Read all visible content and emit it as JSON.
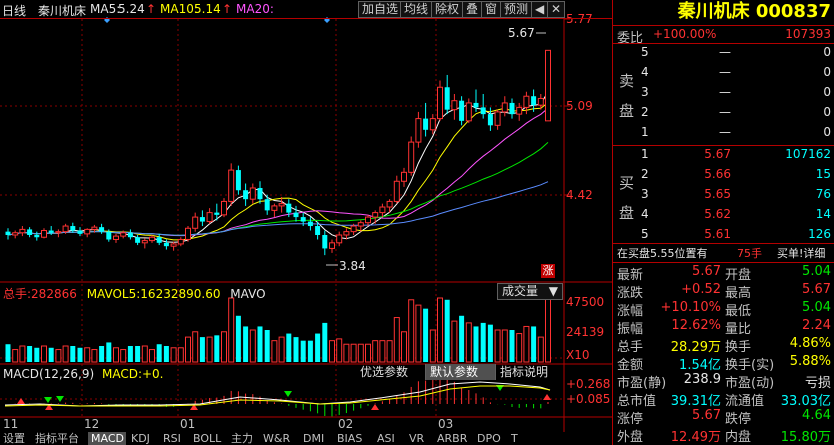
{
  "header": {
    "period": "日线",
    "name": "秦川机床",
    "ma5_label": "MA5:",
    "ma5_value": "5.24",
    "ma10_label": "MA10:",
    "ma10_value": "5.14",
    "ma20_label": "MA20:",
    "ma20_value": "",
    "buttons": [
      "加自选",
      "均线",
      "除权",
      "叠",
      "窗",
      "预测"
    ],
    "colors": {
      "ma5": "#ffffff",
      "ma10": "#ffff00",
      "ma20": "#ff55ff",
      "up": "#ff3232",
      "down": "#00ffff"
    }
  },
  "price_axis": [
    "5.77",
    "5.09",
    "4.42"
  ],
  "price_annotations": {
    "high": "5.67",
    "low": "3.84",
    "marker": "涨"
  },
  "volume": {
    "title_label": "总手:",
    "title_value": "282866",
    "mavol_label": "MAVOL5:",
    "mavol_value": "16232890.60",
    "mavo_label": "MAVO",
    "selector": "成交量",
    "axis": [
      "47500",
      "24139",
      "X10"
    ]
  },
  "macd": {
    "title": "MACD(12,26,9)",
    "macd_label": "MACD:",
    "macd_value": "+0.",
    "buttons": [
      "优选参数",
      "默认参数",
      "指标说明"
    ],
    "axis": [
      "+0.268",
      "+0.085"
    ]
  },
  "date_axis": [
    "11",
    "12",
    "01",
    "02",
    "03"
  ],
  "tabs": [
    "设置",
    "指标平台",
    "MACD",
    "KDJ",
    "RSI",
    "BOLL",
    "主力",
    "W&R",
    "DMI",
    "BIAS",
    "ASI",
    "VR",
    "ARBR",
    "DPO",
    "T"
  ],
  "panel": {
    "title": "秦川机床 000837",
    "weibi_label": "委比",
    "weibi_value": "+100.00%",
    "weicha_value": "107393",
    "sell_label": "卖盘",
    "buy_label": "买盘",
    "sell_levels": [
      {
        "level": "5",
        "price": "—",
        "vol": "0"
      },
      {
        "level": "4",
        "price": "—",
        "vol": "0"
      },
      {
        "level": "3",
        "price": "—",
        "vol": "0"
      },
      {
        "level": "2",
        "price": "—",
        "vol": "0"
      },
      {
        "level": "1",
        "price": "—",
        "vol": "0"
      }
    ],
    "buy_levels": [
      {
        "level": "1",
        "price": "5.67",
        "vol": "107162"
      },
      {
        "level": "2",
        "price": "5.66",
        "vol": "15"
      },
      {
        "level": "3",
        "price": "5.65",
        "vol": "76"
      },
      {
        "level": "4",
        "price": "5.62",
        "vol": "14"
      },
      {
        "level": "5",
        "price": "5.61",
        "vol": "126"
      }
    ],
    "notice_left": "在买盘5.55位置有",
    "notice_mid": "75手",
    "notice_right": "买单!详细",
    "stats": [
      {
        "l1": "最新",
        "v1": "5.67",
        "c1": "red",
        "l2": "开盘",
        "v2": "5.04",
        "c2": "green"
      },
      {
        "l1": "涨跌",
        "v1": "+0.52",
        "c1": "red",
        "l2": "最高",
        "v2": "5.67",
        "c2": "red"
      },
      {
        "l1": "涨幅",
        "v1": "+10.10%",
        "c1": "red",
        "l2": "最低",
        "v2": "5.04",
        "c2": "green"
      },
      {
        "l1": "振幅",
        "v1": "12.62%",
        "c1": "red",
        "l2": "量比",
        "v2": "2.24",
        "c2": "red"
      },
      {
        "l1": "总手",
        "v1": "28.29万",
        "c1": "yellow",
        "l2": "换手",
        "v2": "4.86%",
        "c2": "yellow"
      },
      {
        "l1": "金额",
        "v1": "1.54亿",
        "c1": "cyan",
        "l2": "换手(实)",
        "v2": "5.88%",
        "c2": "yellow"
      },
      {
        "l1": "市盈(静)",
        "v1": "238.9",
        "c1": "white",
        "l2": "市盈(动)",
        "v2": "亏损",
        "c2": "white"
      },
      {
        "l1": "总市值",
        "v1": "39.31亿",
        "c1": "cyan",
        "l2": "流通值",
        "v2": "33.03亿",
        "c2": "cyan"
      },
      {
        "l1": "涨停",
        "v1": "5.67",
        "c1": "red",
        "l2": "跌停",
        "v2": "4.64",
        "c2": "green"
      },
      {
        "l1": "外盘",
        "v1": "12.49万",
        "c1": "red",
        "l2": "内盘",
        "v2": "15.80万",
        "c2": "green"
      }
    ]
  },
  "chart_data": {
    "type": "candlestick",
    "yrange": [
      3.6,
      5.95
    ],
    "candles": [
      [
        4.05,
        4.08,
        3.98,
        4.02
      ],
      [
        4.02,
        4.06,
        3.99,
        4.04
      ],
      [
        4.04,
        4.1,
        4.01,
        4.07
      ],
      [
        4.07,
        4.09,
        4.0,
        4.02
      ],
      [
        4.02,
        4.05,
        3.97,
        4.0
      ],
      [
        4.0,
        4.08,
        3.99,
        4.06
      ],
      [
        4.06,
        4.1,
        4.02,
        4.04
      ],
      [
        4.04,
        4.07,
        4.0,
        4.05
      ],
      [
        4.05,
        4.12,
        4.03,
        4.1
      ],
      [
        4.1,
        4.13,
        4.04,
        4.06
      ],
      [
        4.06,
        4.09,
        4.01,
        4.03
      ],
      [
        4.03,
        4.08,
        4.0,
        4.07
      ],
      [
        4.07,
        4.11,
        4.04,
        4.09
      ],
      [
        4.09,
        4.12,
        4.03,
        4.05
      ],
      [
        4.05,
        4.07,
        3.96,
        3.98
      ],
      [
        3.98,
        4.03,
        3.95,
        4.01
      ],
      [
        4.01,
        4.06,
        3.99,
        4.04
      ],
      [
        4.04,
        4.07,
        3.98,
        4.0
      ],
      [
        4.0,
        4.02,
        3.93,
        3.95
      ],
      [
        3.95,
        3.99,
        3.9,
        3.97
      ],
      [
        3.97,
        4.02,
        3.95,
        4.0
      ],
      [
        4.0,
        4.03,
        3.93,
        3.95
      ],
      [
        3.95,
        3.98,
        3.89,
        3.92
      ],
      [
        3.92,
        3.96,
        3.88,
        3.94
      ],
      [
        3.94,
        4.0,
        3.92,
        3.98
      ],
      [
        3.98,
        4.1,
        3.96,
        4.08
      ],
      [
        4.08,
        4.22,
        4.05,
        4.18
      ],
      [
        4.18,
        4.24,
        4.1,
        4.14
      ],
      [
        4.14,
        4.26,
        4.12,
        4.22
      ],
      [
        4.22,
        4.3,
        4.15,
        4.2
      ],
      [
        4.2,
        4.35,
        4.18,
        4.32
      ],
      [
        4.32,
        4.66,
        4.28,
        4.6
      ],
      [
        4.6,
        4.64,
        4.38,
        4.42
      ],
      [
        4.42,
        4.48,
        4.28,
        4.34
      ],
      [
        4.34,
        4.48,
        4.3,
        4.44
      ],
      [
        4.44,
        4.5,
        4.3,
        4.34
      ],
      [
        4.34,
        4.38,
        4.2,
        4.24
      ],
      [
        4.24,
        4.3,
        4.18,
        4.28
      ],
      [
        4.28,
        4.36,
        4.22,
        4.3
      ],
      [
        4.3,
        4.34,
        4.18,
        4.22
      ],
      [
        4.22,
        4.28,
        4.14,
        4.18
      ],
      [
        4.18,
        4.22,
        4.1,
        4.14
      ],
      [
        4.14,
        4.18,
        4.06,
        4.1
      ],
      [
        4.1,
        4.14,
        3.98,
        4.02
      ],
      [
        4.02,
        4.06,
        3.84,
        3.9
      ],
      [
        3.9,
        3.98,
        3.86,
        3.95
      ],
      [
        3.95,
        4.05,
        3.92,
        4.02
      ],
      [
        4.02,
        4.08,
        3.98,
        4.05
      ],
      [
        4.05,
        4.12,
        4.02,
        4.1
      ],
      [
        4.1,
        4.15,
        4.05,
        4.13
      ],
      [
        4.13,
        4.2,
        4.1,
        4.18
      ],
      [
        4.18,
        4.24,
        4.12,
        4.22
      ],
      [
        4.22,
        4.3,
        4.18,
        4.27
      ],
      [
        4.27,
        4.34,
        4.22,
        4.32
      ],
      [
        4.32,
        4.55,
        4.3,
        4.5
      ],
      [
        4.5,
        4.62,
        4.45,
        4.58
      ],
      [
        4.58,
        4.9,
        4.55,
        4.85
      ],
      [
        4.85,
        5.12,
        4.8,
        5.06
      ],
      [
        5.06,
        5.2,
        4.9,
        4.96
      ],
      [
        4.96,
        5.1,
        4.92,
        5.06
      ],
      [
        5.06,
        5.4,
        5.04,
        5.34
      ],
      [
        5.34,
        5.45,
        5.1,
        5.14
      ],
      [
        5.14,
        5.28,
        5.05,
        5.22
      ],
      [
        5.22,
        5.26,
        5.0,
        5.04
      ],
      [
        5.04,
        5.24,
        5.02,
        5.2
      ],
      [
        5.2,
        5.32,
        5.12,
        5.16
      ],
      [
        5.16,
        5.28,
        5.06,
        5.1
      ],
      [
        5.1,
        5.16,
        4.95,
        5.0
      ],
      [
        5.0,
        5.14,
        4.96,
        5.12
      ],
      [
        5.12,
        5.26,
        5.08,
        5.2
      ],
      [
        5.2,
        5.24,
        5.06,
        5.1
      ],
      [
        5.1,
        5.2,
        5.04,
        5.16
      ],
      [
        5.16,
        5.3,
        5.1,
        5.26
      ],
      [
        5.26,
        5.32,
        5.12,
        5.18
      ],
      [
        5.18,
        5.28,
        5.14,
        5.24
      ],
      [
        5.04,
        5.67,
        5.04,
        5.67
      ]
    ]
  }
}
